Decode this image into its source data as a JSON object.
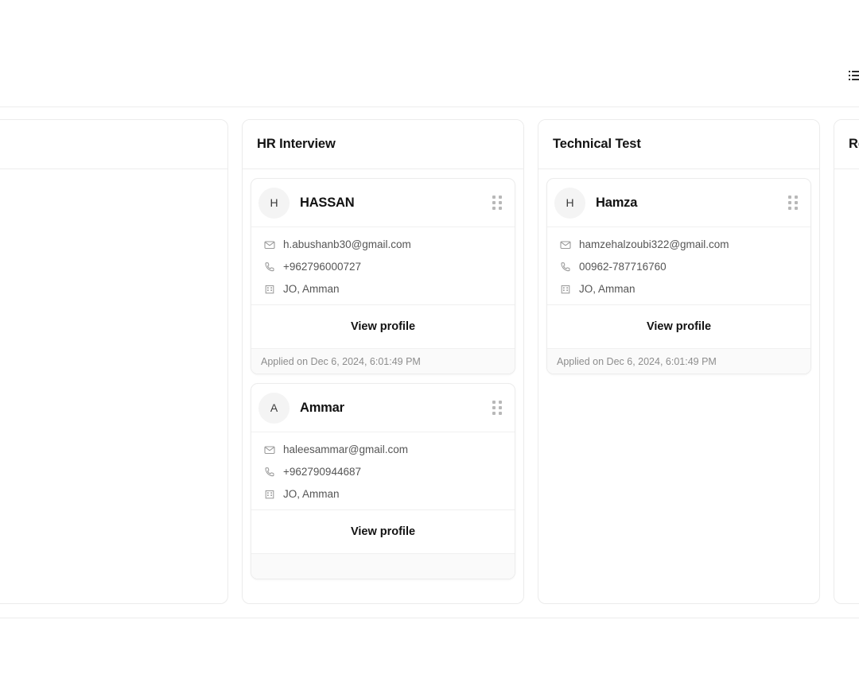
{
  "topbar": {
    "view_toggle_icon": "list-icon"
  },
  "board": {
    "columns": [
      {
        "id": "column-partial-left",
        "title": "",
        "cards": []
      },
      {
        "id": "column-hr-interview",
        "title": "HR Interview",
        "cards": [
          {
            "initial": "H",
            "name": "HASSAN",
            "email": "h.abushanb30@gmail.com",
            "phone": "+962796000727",
            "location": "JO, Amman",
            "view_profile_label": "View profile",
            "applied_on": "Applied on Dec 6, 2024, 6:01:49 PM"
          },
          {
            "initial": "A",
            "name": "Ammar",
            "email": "haleesammar@gmail.com",
            "phone": "+962790944687",
            "location": "JO, Amman",
            "view_profile_label": "View profile",
            "applied_on": ""
          }
        ]
      },
      {
        "id": "column-technical-test",
        "title": "Technical Test",
        "cards": [
          {
            "initial": "H",
            "name": "Hamza",
            "email": "hamzehalzoubi322@gmail.com",
            "phone": "00962-787716760",
            "location": "JO, Amman",
            "view_profile_label": "View profile",
            "applied_on": "Applied on Dec 6, 2024, 6:01:49 PM"
          }
        ]
      },
      {
        "id": "column-rejected",
        "title": "Rejected",
        "cards": []
      }
    ]
  },
  "icons": {
    "email": "envelope-icon",
    "phone": "phone-icon",
    "location": "building-icon",
    "drag": "drag-handle-icon"
  },
  "colors": {
    "page_background": "#ffffff",
    "card_border": "#ececec",
    "text_primary": "#121212",
    "text_secondary": "#555555",
    "text_muted": "#8d8d8d",
    "avatar_background": "#f4f4f4",
    "footer_background": "#fafafa"
  }
}
